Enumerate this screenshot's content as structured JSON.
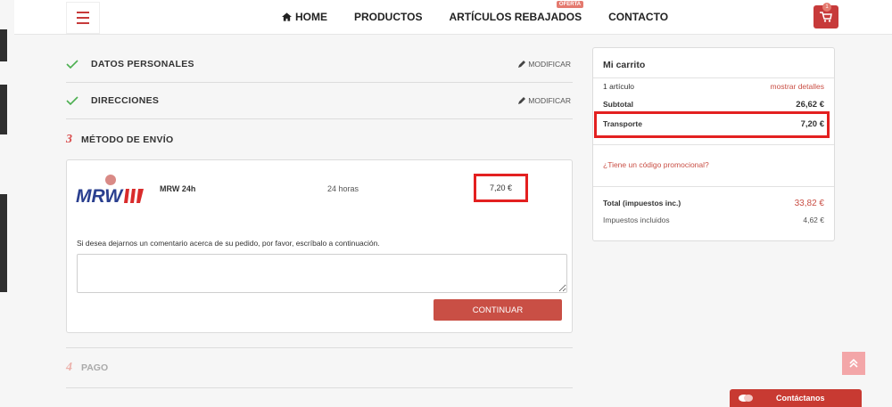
{
  "header": {
    "nav": [
      "HOME",
      "PRODUCTOS",
      "ARTÍCULOS REBAJADOS",
      "CONTACTO"
    ],
    "oferta_badge": "OFERTA",
    "cart_count": "1"
  },
  "checkout": {
    "step1": {
      "title": "DATOS PERSONALES",
      "action": "MODIFICAR"
    },
    "step2": {
      "title": "DIRECCIONES",
      "action": "MODIFICAR"
    },
    "step3": {
      "num": "3",
      "title": "MÉTODO DE ENVÍO"
    },
    "shipping": {
      "logo_text": "MRW",
      "carrier": "MRW 24h",
      "delay": "24 horas",
      "price": "7,20 €",
      "comment_label": "Si desea dejarnos un comentario acerca de su pedido, por favor, escríbalo a continuación.",
      "comment_value": "",
      "continue_label": "CONTINUAR"
    },
    "step4": {
      "num": "4",
      "title": "PAGO"
    }
  },
  "cart": {
    "title": "Mi carrito",
    "items_count": "1 artículo",
    "details_link": "mostrar detalles",
    "subtotal_label": "Subtotal",
    "subtotal_value": "26,62 €",
    "transport_label": "Transporte",
    "transport_value": "7,20 €",
    "promo_link": "¿Tiene un código promocional?",
    "total_label": "Total (impuestos inc.)",
    "total_value": "33,82 €",
    "tax_label": "Impuestos incluidos",
    "tax_value": "4,62 €"
  },
  "contact_button": "Contáctanos",
  "colors": {
    "accent": "#c94f45",
    "highlight": "#e32020"
  }
}
